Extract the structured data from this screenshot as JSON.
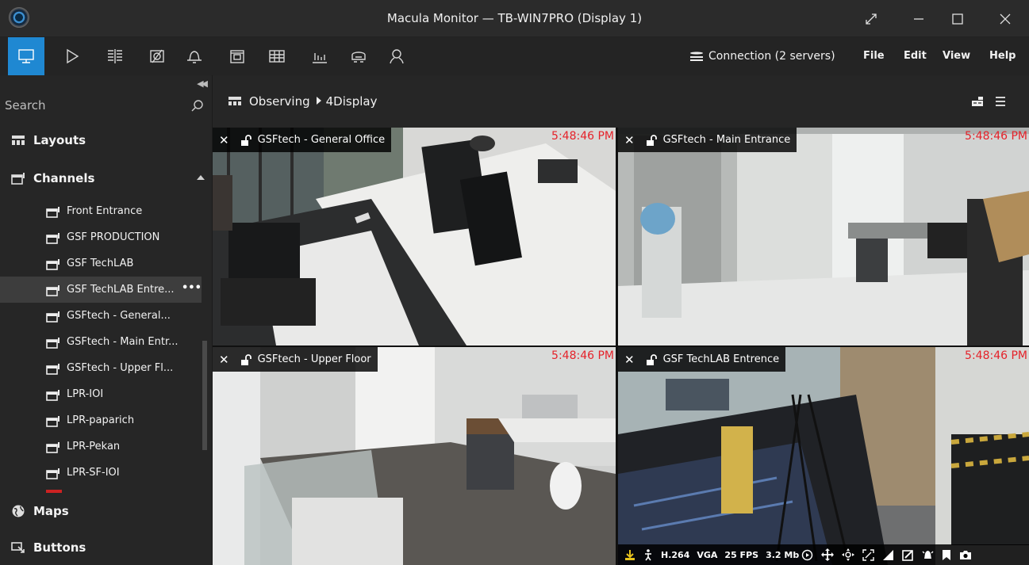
{
  "window": {
    "title": "Macula Monitor — TB-WIN7PRO (Display 1)",
    "buttons": [
      "expand-icon",
      "minimize-icon",
      "maximize-icon",
      "close-icon"
    ]
  },
  "toolbar": {
    "tools": [
      "monitor-icon",
      "play-icon",
      "grid-layout-icon",
      "no-signal-icon",
      "bell-icon",
      "archive-icon",
      "table-icon",
      "chart-icon",
      "vehicle-icon",
      "person-icon"
    ],
    "connection_label": "Connection (2 servers)",
    "menu": [
      "File",
      "Edit",
      "View",
      "Help"
    ],
    "accent": "#1f88d2"
  },
  "sidebar": {
    "search_placeholder": "Search",
    "sections": {
      "layouts": "Layouts",
      "channels": "Channels",
      "maps": "Maps",
      "buttons": "Buttons"
    },
    "channels": [
      {
        "label": "Front Entrance",
        "selected": false
      },
      {
        "label": "GSF PRODUCTION",
        "selected": false
      },
      {
        "label": "GSF TechLAB",
        "selected": false
      },
      {
        "label": "GSF TechLAB Entre...",
        "selected": true
      },
      {
        "label": "GSFtech - General...",
        "selected": false
      },
      {
        "label": "GSFtech - Main Entr...",
        "selected": false
      },
      {
        "label": "GSFtech - Upper Fl...",
        "selected": false
      },
      {
        "label": "LPR-IOI",
        "selected": false
      },
      {
        "label": "LPR-paparich",
        "selected": false
      },
      {
        "label": "LPR-Pekan",
        "selected": false
      },
      {
        "label": "LPR-SF-IOI",
        "selected": false
      }
    ],
    "selected_more": "•••"
  },
  "breadcrumb": {
    "parts": [
      "Observing",
      "4Display"
    ]
  },
  "tiles": [
    {
      "name": "GSFtech - General Office",
      "time": "5:48:46 PM",
      "selected": false
    },
    {
      "name": "GSFtech - Main Entrance",
      "time": "5:48:46 PM",
      "selected": false
    },
    {
      "name": "GSFtech - Upper Floor",
      "time": "5:48:46 PM",
      "selected": false
    },
    {
      "name": "GSF TechLAB Entrence",
      "time": "5:48:46 PM",
      "selected": true
    }
  ],
  "stream": {
    "codec": "H.264",
    "resolution": "VGA",
    "fps": "25 FPS",
    "bitrate": "3.2 Mb"
  },
  "colors": {
    "timestamp": "#e5222a",
    "selected_border": "#e6c21d"
  }
}
